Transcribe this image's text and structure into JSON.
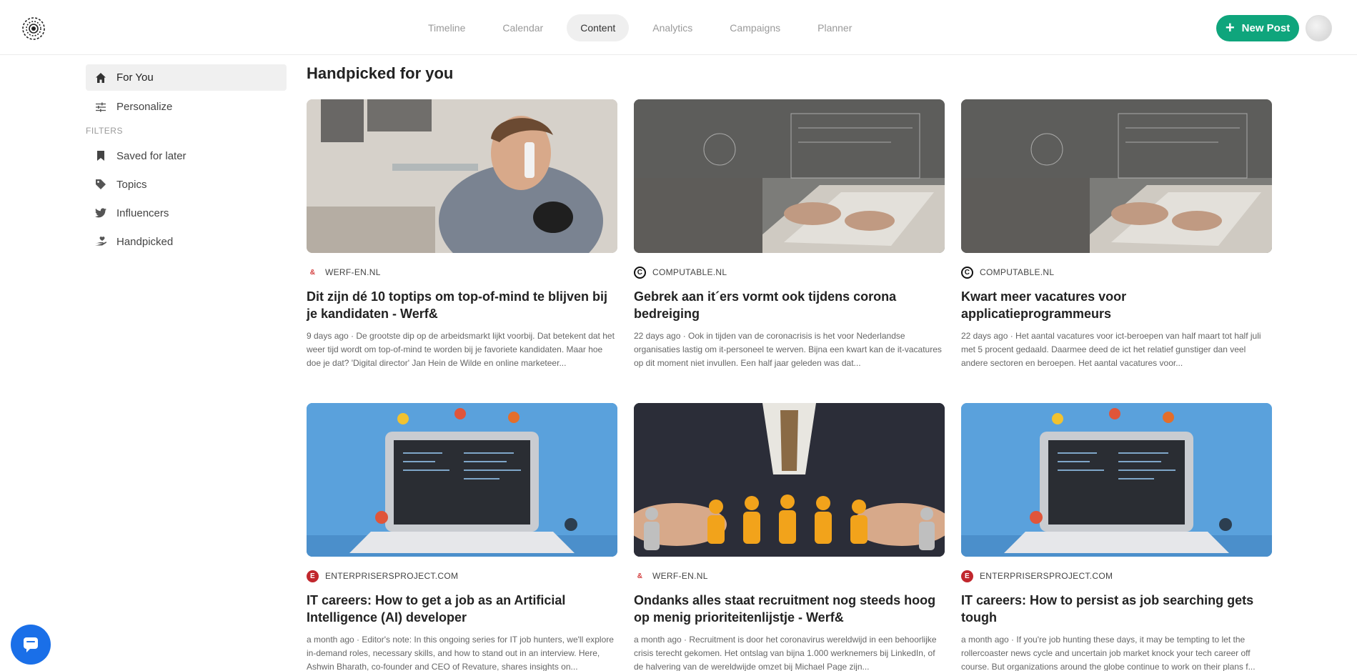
{
  "nav": {
    "tabs": [
      {
        "label": "Timeline"
      },
      {
        "label": "Calendar"
      },
      {
        "label": "Content"
      },
      {
        "label": "Analytics"
      },
      {
        "label": "Campaigns"
      },
      {
        "label": "Planner"
      }
    ],
    "active_tab": "Content",
    "new_post_label": "New Post",
    "accent_color": "#0fa57c"
  },
  "sidebar": {
    "items": [
      {
        "label": "For You",
        "icon": "home-icon"
      },
      {
        "label": "Personalize",
        "icon": "sliders-icon"
      }
    ],
    "filters_heading": "FILTERS",
    "filters": [
      {
        "label": "Saved for later",
        "icon": "bookmark-icon"
      },
      {
        "label": "Topics",
        "icon": "tag-icon"
      },
      {
        "label": "Influencers",
        "icon": "twitter-icon"
      },
      {
        "label": "Handpicked",
        "icon": "hand-heart-icon"
      }
    ]
  },
  "main": {
    "title": "Handpicked for you",
    "cards": [
      {
        "source": "WERF-EN.NL",
        "source_icon": "werf-logo-icon",
        "title": "Dit zijn dé 10 toptips om top-of-mind te blijven bij je kandidaten - Werf&",
        "description": "9 days ago · De grootste dip op de arbeidsmarkt lijkt voorbij. Dat betekent dat het weer tijd wordt om top-of-mind te worden bij je favoriete kandidaten. Maar hoe doe je dat? 'Digital director' Jan Hein de Wilde en online marketeer..."
      },
      {
        "source": "COMPUTABLE.NL",
        "source_icon": "computable-logo-icon",
        "title": "Gebrek aan it´ers vormt ook tijdens corona bedreiging",
        "description": "22 days ago · Ook in tijden van de coronacrisis is het voor Nederlandse organisaties lastig om it-personeel te werven. Bijna een kwart kan de it-vacatures op dit moment niet invullen. Een half jaar geleden was dat..."
      },
      {
        "source": "COMPUTABLE.NL",
        "source_icon": "computable-logo-icon",
        "title": "Kwart meer vacatures voor applicatieprogrammeurs",
        "description": "22 days ago · Het aantal vacatures voor ict-beroepen van half maart tot half juli met 5 procent gedaald. Daarmee deed de ict het relatief gunstiger dan veel andere sectoren en beroepen. Het aantal vacatures voor..."
      },
      {
        "source": "ENTERPRISERSPROJECT.COM",
        "source_icon": "enterprisers-logo-icon",
        "title": "IT careers: How to get a job as an Artificial Intelligence (AI) developer",
        "description": "a month ago · Editor's note: In this ongoing series for IT job hunters, we'll explore in-demand roles, necessary skills, and how to stand out in an interview. Here, Ashwin Bharath, co-founder and CEO of Revature, shares insights on..."
      },
      {
        "source": "WERF-EN.NL",
        "source_icon": "werf-logo-icon",
        "title": "Ondanks alles staat recruitment nog steeds hoog op menig prioriteitenlijstje - Werf&",
        "description": "a month ago · Recruitment is door het coronavirus wereldwijd in een behoorlijke crisis terecht gekomen. Het ontslag van bijna 1.000 werknemers bij LinkedIn, of de halvering van de wereldwijde omzet bij Michael Page zijn..."
      },
      {
        "source": "ENTERPRISERSPROJECT.COM",
        "source_icon": "enterprisers-logo-icon",
        "title": "IT careers: How to persist as job searching gets tough",
        "description": "a month ago · If you're job hunting these days, it may be tempting to let the rollercoaster news cycle and uncertain job market knock your tech career off course. But organizations around the globe continue to work on their plans f..."
      }
    ]
  }
}
